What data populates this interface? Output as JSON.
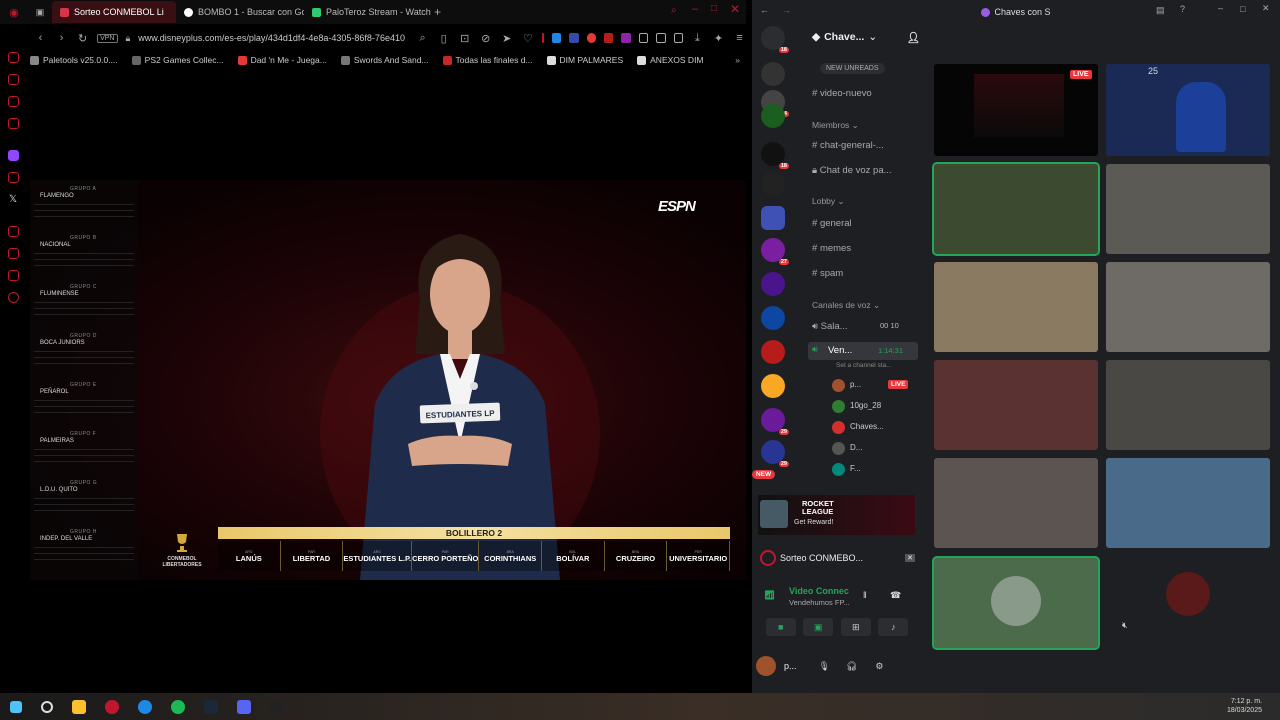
{
  "browser": {
    "tabs": [
      {
        "label": "Sorteo CONMEBOL Li",
        "color": "#d63447"
      },
      {
        "label": "BOMBO 1 - Buscar con Go",
        "color": "#ffffff"
      },
      {
        "label": "PaloTeroz Stream - Watch",
        "color": "#2ecc71"
      }
    ],
    "new_tab": "+",
    "address": "www.disneyplus.com/es-es/play/434d1df4-4e8a-4305-86f8-76e410",
    "vpn_label": "VPN",
    "bookmarks": [
      "Paletools v25.0.0....",
      "PS2 Games Collec...",
      "Dad 'n Me - Juega...",
      "Swords And Sand...",
      "Todas las finales d...",
      "DIM PALMARES",
      "ANEXOS DIM"
    ]
  },
  "broadcast": {
    "logo": "ESPN",
    "card_text": "ESTUDIANTES LP",
    "bombo_title": "BOLILLERO 2",
    "competition": "CONMEBOL LIBERTADORES",
    "groups": [
      {
        "label": "GRUPO A",
        "team": "FLAMENGO"
      },
      {
        "label": "GRUPO B",
        "team": "NACIONAL"
      },
      {
        "label": "GRUPO C",
        "team": "FLUMINENSE"
      },
      {
        "label": "GRUPO D",
        "team": "BOCA JUNIORS"
      },
      {
        "label": "GRUPO E",
        "team": "PEÑAROL"
      },
      {
        "label": "GRUPO F",
        "team": "PALMEIRAS"
      },
      {
        "label": "GRUPO G",
        "team": "L.D.U. QUITO"
      },
      {
        "label": "GRUPO H",
        "team": "INDEP. DEL VALLE"
      }
    ],
    "teams": [
      {
        "country": "ARG",
        "name": "LANÚS"
      },
      {
        "country": "PAR",
        "name": "LIBERTAD"
      },
      {
        "country": "ARG",
        "name": "ESTUDIANTES L.P."
      },
      {
        "country": "PAR",
        "name": "CERRO PORTEÑO"
      },
      {
        "country": "BRA",
        "name": "CORINTHIANS"
      },
      {
        "country": "BOL",
        "name": "BOLÍVAR"
      },
      {
        "country": "BRA",
        "name": "CRUZEIRO"
      },
      {
        "country": "PER",
        "name": "UNIVERSITARIO"
      }
    ]
  },
  "discord": {
    "window_title": "Chaves con S",
    "server_name": "Chave...",
    "server_badges": [
      "18",
      "14",
      "18",
      "27",
      "29",
      "29",
      "NEW"
    ],
    "new_unreads": "NEW UNREADS",
    "channels": {
      "video_nuevo": "video-nuevo",
      "cat_miembros": "Miembros",
      "chat_general": "chat-general-...",
      "chat_voz": "Chat de voz pa...",
      "cat_lobby": "Lobby",
      "general": "general",
      "memes": "memes",
      "spam": "spam",
      "cat_voz": "Canales de voz",
      "sala": "Sala...",
      "sala_count_a": "00",
      "sala_count_b": "10",
      "ven": "Ven...",
      "ven_time": "1:14:31",
      "status_hint": "Set a channel sta..."
    },
    "voice_users": [
      "p...",
      "10go_28",
      "Chaves...",
      "D...",
      "F..."
    ],
    "live_label": "LIVE",
    "rocket": {
      "title": "ROCKET LEAGUE",
      "subtitle": "Get Reward!"
    },
    "activity": "Sorteo CONMEBO...",
    "video_connected": "Video Connec",
    "video_sub": "Vendehumos FP...",
    "username": "p...",
    "score_badge": "25"
  },
  "taskbar": {
    "time": "7:12 p. m.",
    "date": "18/03/2025"
  },
  "colors": {
    "accent": "#c0172e",
    "discord_green": "#23a55a",
    "live_red": "#e8383d"
  }
}
